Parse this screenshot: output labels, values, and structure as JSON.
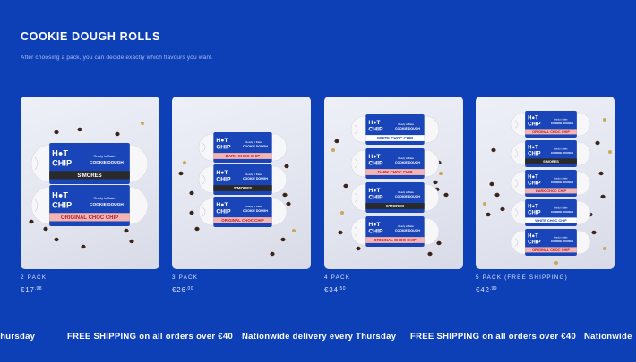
{
  "section": {
    "title": "COOKIE DOUGH ROLLS",
    "subtitle": "After choosing a pack, you can decide exactly which flavours you want."
  },
  "packs": [
    {
      "name": "2 PACK",
      "price_main": "€17",
      "price_cents": ".98",
      "roll_labels": [
        "S'MORES",
        "ORIGINAL CHOC CHIP"
      ]
    },
    {
      "name": "3 PACK",
      "price_main": "€26",
      "price_cents": ".00",
      "roll_labels": [
        "DARK CHOC CHIP",
        "S'MORES",
        "ORIGINAL CHOC CHIP"
      ]
    },
    {
      "name": "4 PACK",
      "price_main": "€34",
      "price_cents": ".50",
      "roll_labels": [
        "WHITE CHOC CHIP",
        "DARK CHOC CHIP",
        "S'MORES",
        "ORIGINAL CHOC CHIP"
      ]
    },
    {
      "name": "5 PACK (FREE SHIPPING)",
      "price_main": "€42",
      "price_cents": ".99",
      "roll_labels": [
        "ORIGINAL CHOC CHIP",
        "S'MORES",
        "DARK CHOC CHIP",
        "WHITE CHOC CHIP",
        "ORIGINAL CHOC CHIP"
      ]
    }
  ],
  "brand": {
    "logo_line1": "H●T",
    "logo_line2": "CHIP",
    "product_line1": "Ready to Bake",
    "product_line2": "COOKIE DOUGH"
  },
  "ticker": {
    "items": [
      "ery Thursday",
      "FREE SHIPPING on all orders over €40",
      "Nationwide delivery every Thursday",
      "FREE SHIPPING on all orders over €40",
      "Nationwide"
    ]
  },
  "colors": {
    "background": "#0d40b6",
    "wrapper_blue": "#1a45b8",
    "label_pink": "#f3b4b4",
    "label_black": "#2a2a2a",
    "chip_brown": "#3b2419",
    "sprinkle_gold": "#c9a85a"
  }
}
